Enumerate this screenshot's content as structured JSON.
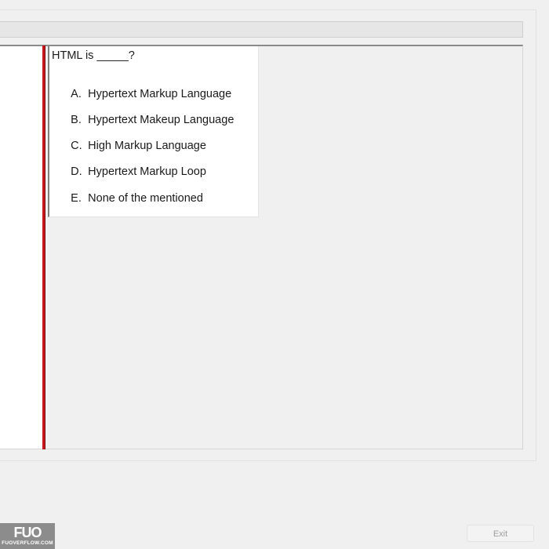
{
  "question": {
    "text": "HTML is _____?",
    "options": [
      {
        "letter": "A.",
        "text": "Hypertext Markup Language"
      },
      {
        "letter": "B.",
        "text": "Hypertext Makeup Language"
      },
      {
        "letter": "C.",
        "text": "High Markup Language"
      },
      {
        "letter": "D.",
        "text": "Hypertext Markup Loop"
      },
      {
        "letter": "E.",
        "text": "None of the mentioned"
      }
    ]
  },
  "footer": {
    "logo_mark": "FUO",
    "logo_text": "FUOVERFLOW.COM",
    "exit_label": "Exit"
  },
  "colors": {
    "divider": "#c8161d",
    "background": "#f0f0f0",
    "question_background": "#ffffff"
  }
}
